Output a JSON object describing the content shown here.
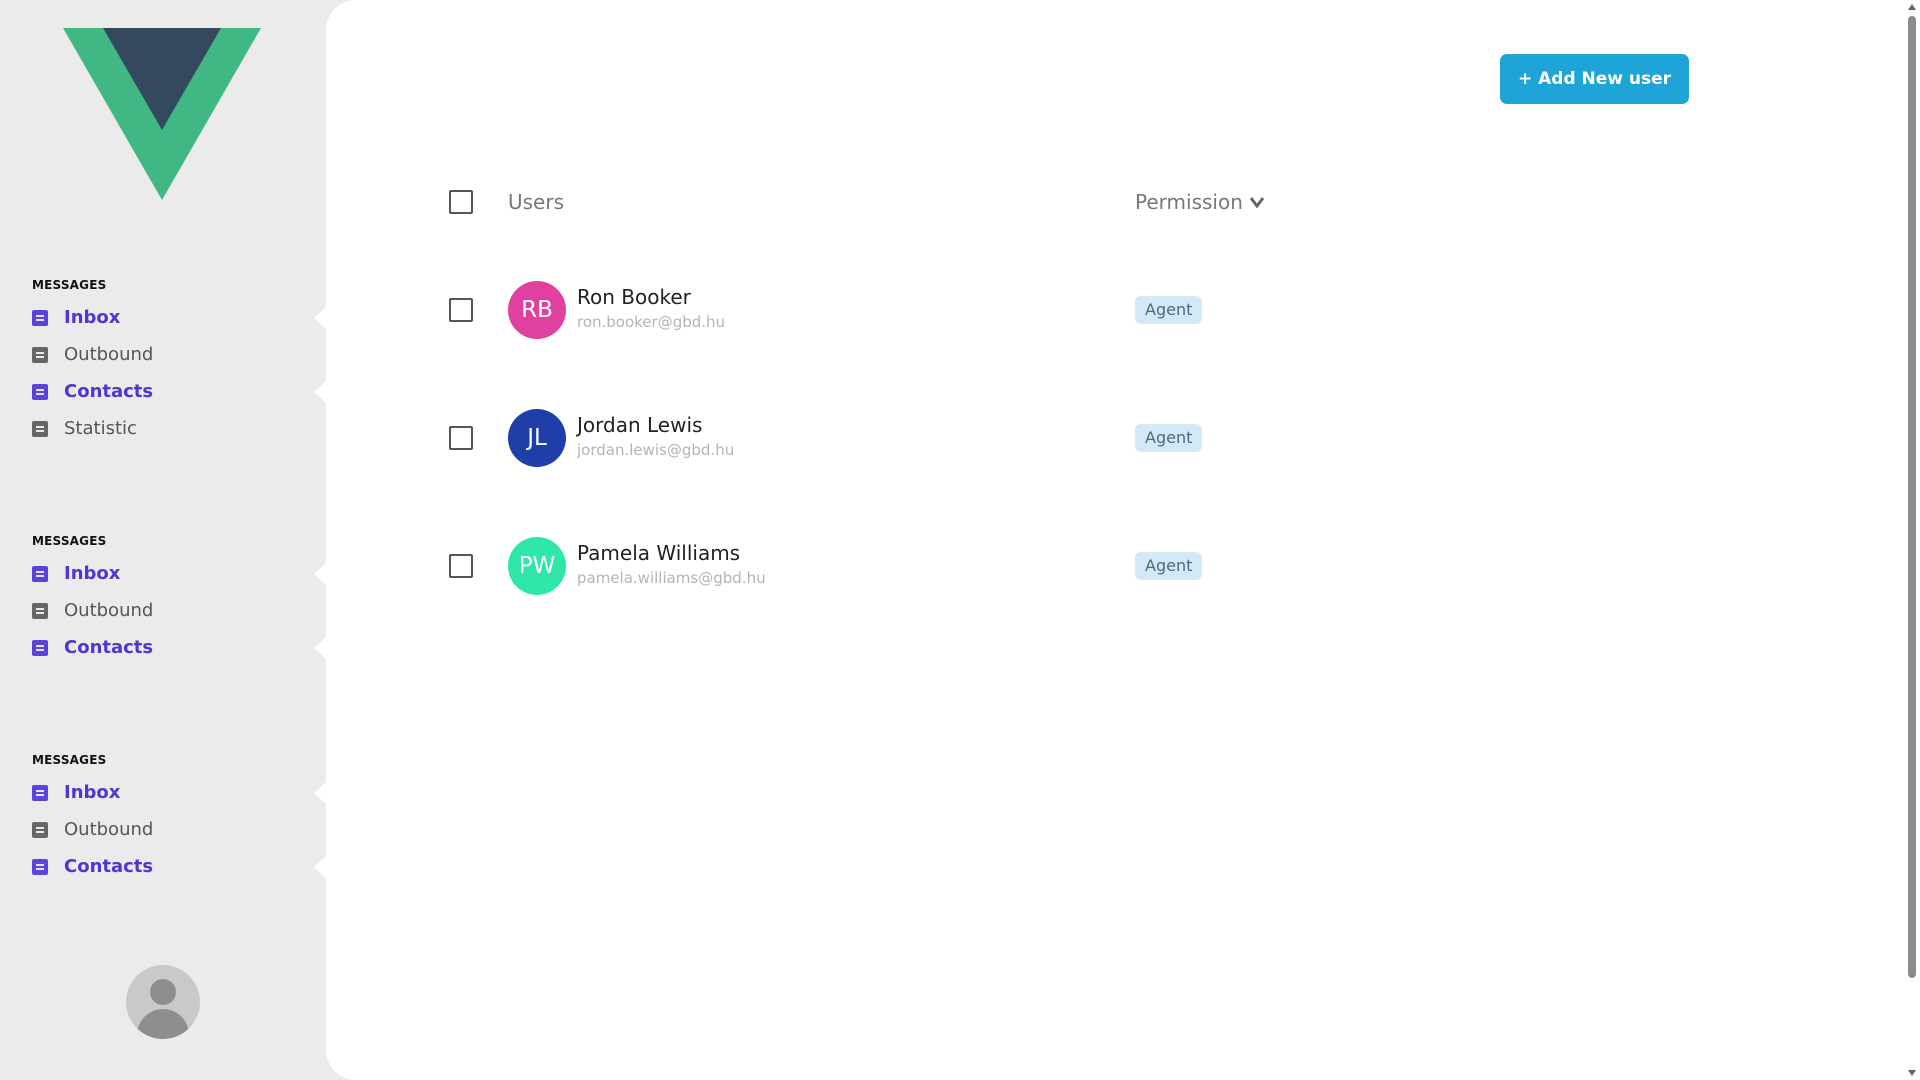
{
  "sidebar": {
    "logo": "vue-logo",
    "groups": [
      {
        "title": "MESSAGES",
        "items": [
          {
            "label": "Inbox",
            "icon": "book-icon",
            "active": true
          },
          {
            "label": "Outbound",
            "icon": "book-icon",
            "active": false
          },
          {
            "label": "Contacts",
            "icon": "book-icon",
            "active": true
          },
          {
            "label": "Statistic",
            "icon": "book-icon",
            "active": false
          }
        ]
      },
      {
        "title": "MESSAGES",
        "items": [
          {
            "label": "Inbox",
            "icon": "book-icon",
            "active": true
          },
          {
            "label": "Outbound",
            "icon": "book-icon",
            "active": false
          },
          {
            "label": "Contacts",
            "icon": "book-icon",
            "active": true
          }
        ]
      },
      {
        "title": "MESSAGES",
        "items": [
          {
            "label": "Inbox",
            "icon": "book-icon",
            "active": true
          },
          {
            "label": "Outbound",
            "icon": "book-icon",
            "active": false
          },
          {
            "label": "Contacts",
            "icon": "book-icon",
            "active": true
          }
        ]
      }
    ],
    "user_avatar": "user-icon"
  },
  "main": {
    "add_button_label": "+ Add New user",
    "table": {
      "col_users": "Users",
      "col_permission": "Permission",
      "rows": [
        {
          "initials": "RB",
          "name": "Ron Booker",
          "email": "ron.booker@gbd.hu",
          "permission": "Agent",
          "avatar_color": "#e0409f"
        },
        {
          "initials": "JL",
          "name": "Jordan Lewis",
          "email": "jordan.lewis@gbd.hu",
          "permission": "Agent",
          "avatar_color": "#1f3ea8"
        },
        {
          "initials": "PW",
          "name": "Pamela Williams",
          "email": "pamela.williams@gbd.hu",
          "permission": "Agent",
          "avatar_color": "#2ee6a8"
        }
      ]
    }
  },
  "colors": {
    "accent": "#4f35d2",
    "button": "#1ea4d6",
    "badge_bg": "#d4e9f7",
    "vue_green": "#41b883",
    "vue_dark": "#35495e"
  }
}
